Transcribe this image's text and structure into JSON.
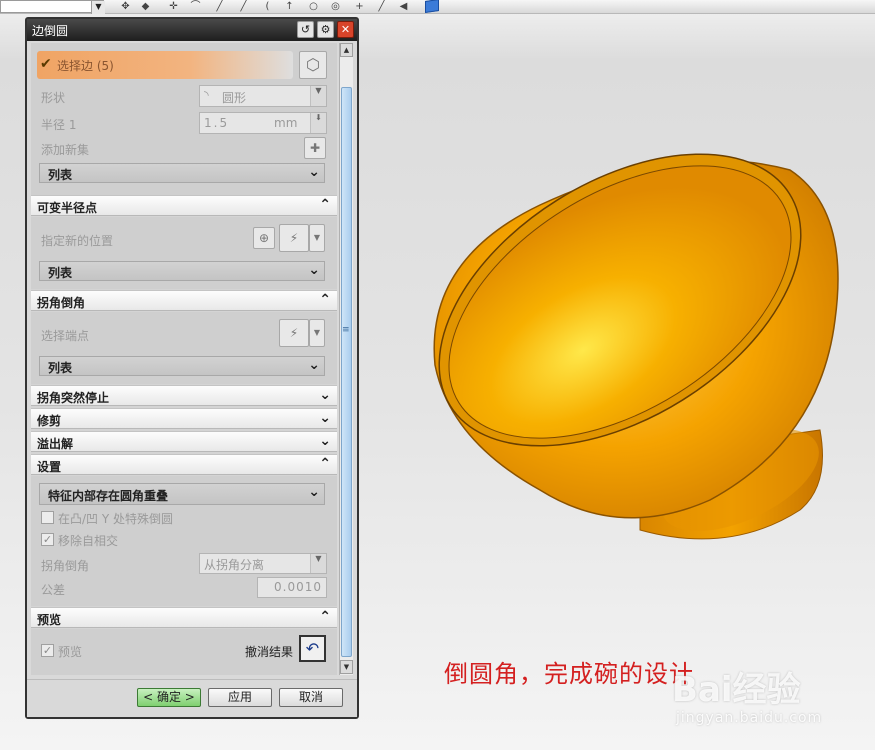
{
  "toolbar": {
    "icons": [
      "move-icon",
      "snap-icon",
      "point-icon",
      "line-icon",
      "arc-icon",
      "circle-icon",
      "plus-icon",
      "arrow-icon",
      "shield-icon",
      "cube-icon"
    ]
  },
  "dialog": {
    "title": "边倒圆",
    "select_edge": {
      "label": "选择边 (5)"
    },
    "shape": {
      "label": "形状",
      "value": "圆形"
    },
    "radius": {
      "label": "半径 1",
      "value": "1.5",
      "unit": "mm"
    },
    "add_new_set": {
      "label": "添加新集"
    },
    "list_label": "列表",
    "variable_radius": {
      "header": "可变半径点",
      "specify_location": "指定新的位置",
      "list_label": "列表"
    },
    "corner_setback": {
      "header": "拐角倒角",
      "select_endpoint": "选择端点",
      "list_label": "列表"
    },
    "corner_stop": {
      "header": "拐角突然停止"
    },
    "trim": {
      "header": "修剪"
    },
    "overflow": {
      "header": "溢出解"
    },
    "settings": {
      "header": "设置",
      "overlap_option": "特征内部存在圆角重叠",
      "y_blend_label": "在凸/凹 Y 处特殊倒圆",
      "y_blend_checked": false,
      "remove_self_intersect_label": "移除自相交",
      "remove_self_intersect_checked": true,
      "corner_setback_label": "拐角倒角",
      "corner_setback_value": "从拐角分离",
      "tolerance_label": "公差",
      "tolerance_value": "0.0010"
    },
    "preview": {
      "header": "预览",
      "preview_label": "预览",
      "preview_checked": true,
      "undo_result_label": "撤消结果"
    },
    "buttons": {
      "ok": "< 确定 >",
      "apply": "应用",
      "cancel": "取消"
    }
  },
  "caption": "倒圆角，完成碗的设计",
  "watermark": {
    "logo": "Bai经验",
    "url": "jingyan.baidu.com"
  },
  "colors": {
    "bowl": "#f5a300",
    "caption": "#d42020",
    "select_highlight": "#f0a464"
  }
}
